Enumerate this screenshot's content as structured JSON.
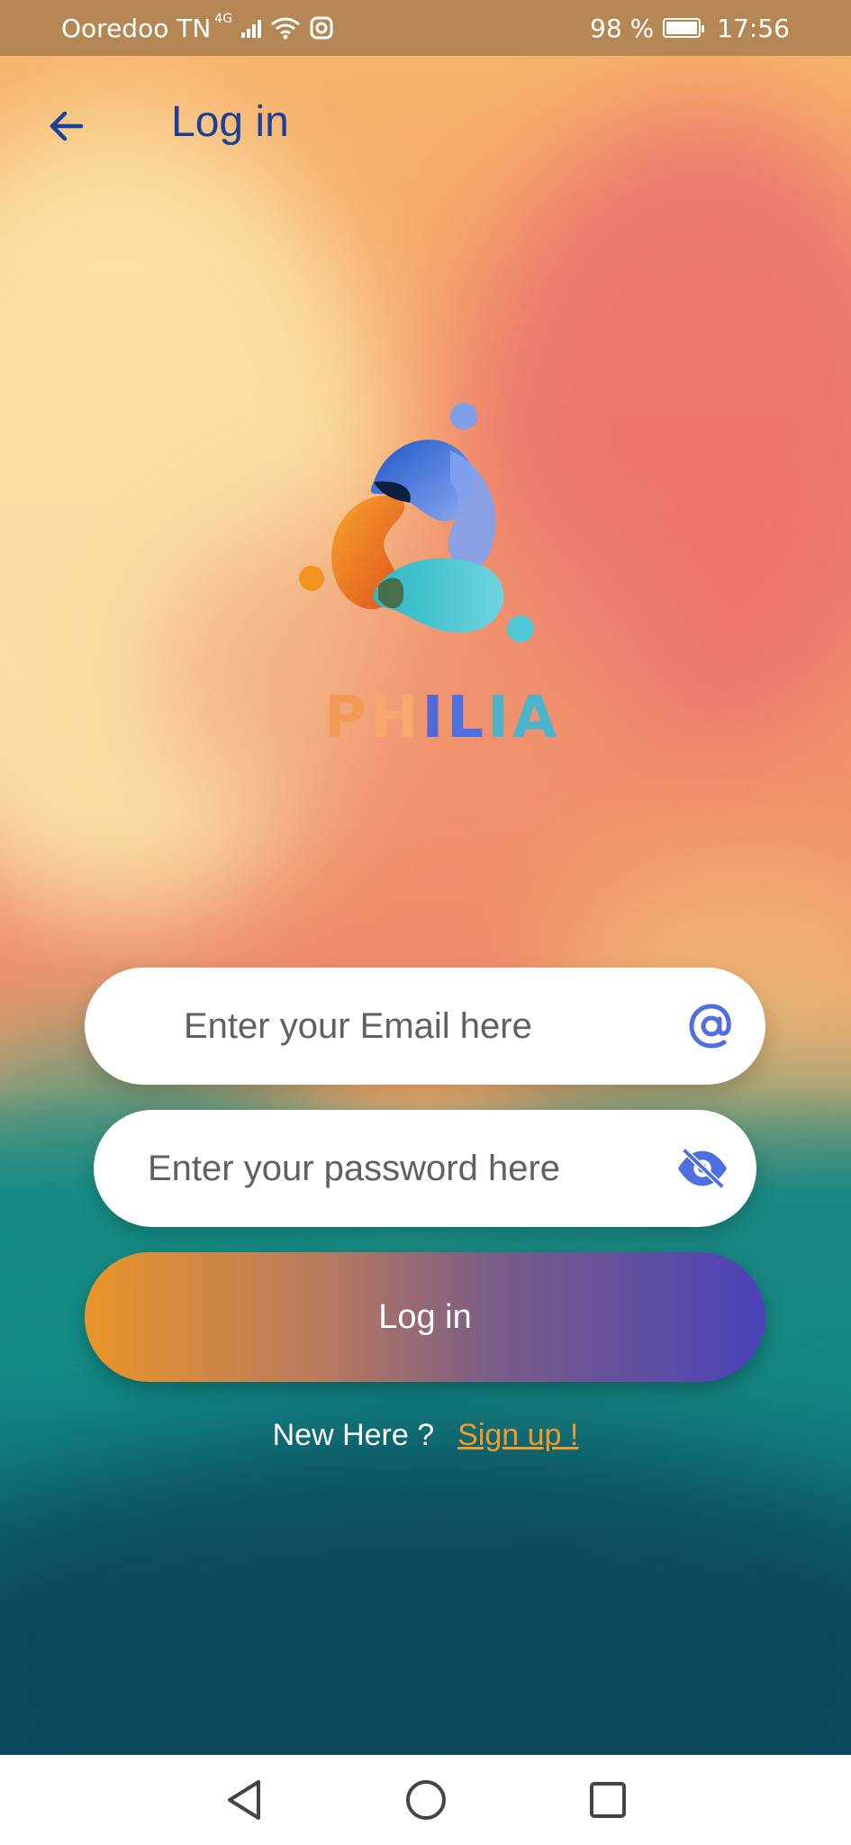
{
  "status_bar": {
    "carrier": "Ooredoo TN",
    "network": "4G",
    "battery_percent": "98 %",
    "time": "17:56"
  },
  "app_bar": {
    "title": "Log in",
    "back_icon": "arrow-left-icon"
  },
  "logo": {
    "letters": [
      "P",
      "H",
      "I",
      "L",
      "I",
      "A"
    ]
  },
  "form": {
    "email_placeholder": "Enter your Email here",
    "email_icon": "at-sign-icon",
    "password_placeholder": "Enter your password here",
    "password_icon": "eye-off-icon",
    "login_label": "Log in"
  },
  "signup": {
    "prompt": "New Here ?",
    "link": "Sign up !"
  },
  "nav_bar": {
    "back": "triangle-back-icon",
    "home": "circle-home-icon",
    "recents": "square-recents-icon"
  },
  "colors": {
    "title": "#1c3f9b",
    "accent_orange": "#f39b2a",
    "accent_blue": "#4a43b9",
    "icon_blue": "#4d6fe0"
  }
}
